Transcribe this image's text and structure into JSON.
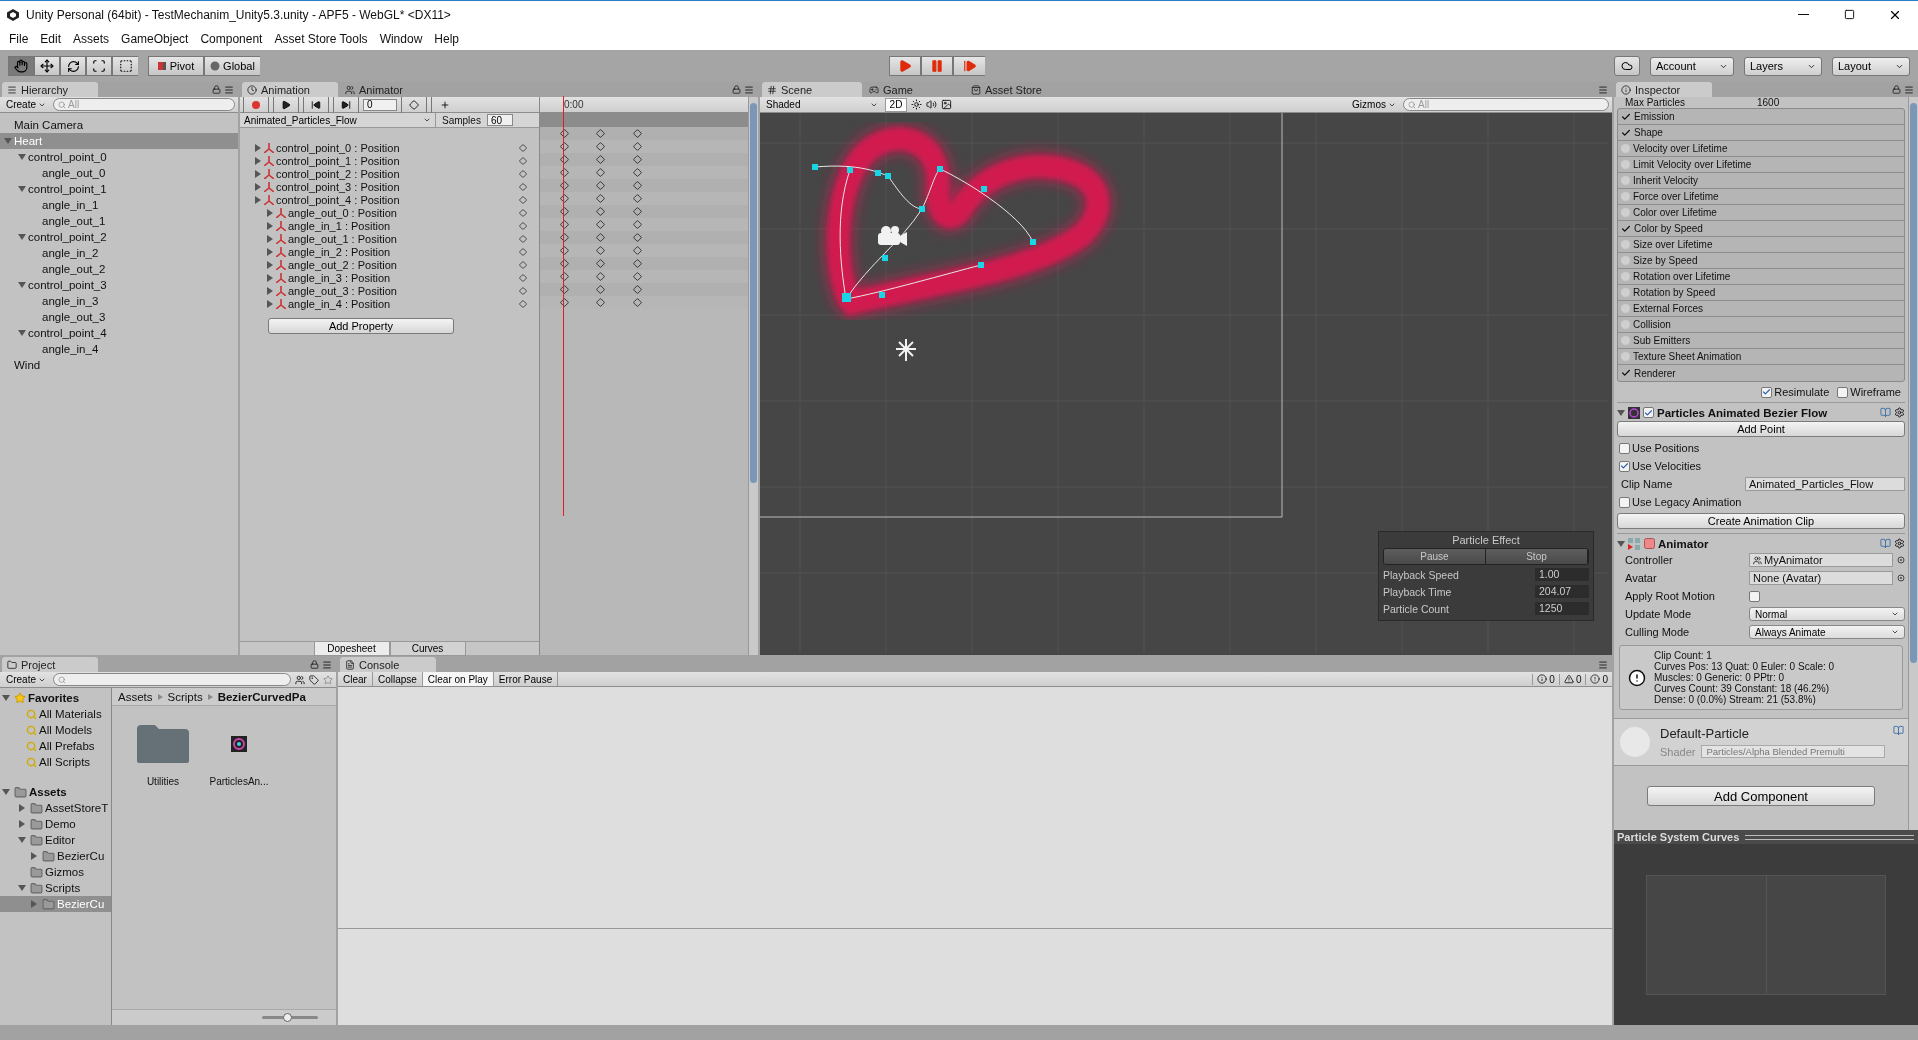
{
  "window": {
    "title": "Unity Personal (64bit) - TestMechanim_Unity5.3.unity - APF5 - WebGL* <DX11>"
  },
  "menu": [
    "File",
    "Edit",
    "Assets",
    "GameObject",
    "Component",
    "Asset Store Tools",
    "Window",
    "Help"
  ],
  "toolbar": {
    "tools": [
      {
        "kind": "hand",
        "selected": true
      },
      {
        "kind": "move",
        "selected": false
      },
      {
        "kind": "rotate",
        "selected": false
      },
      {
        "kind": "scale",
        "selected": false
      },
      {
        "kind": "rect",
        "selected": false
      }
    ],
    "pivot": "Pivot",
    "global": "Global",
    "account": "Account",
    "layers": "Layers",
    "layout": "Layout"
  },
  "hierarchy": {
    "tab": "Hierarchy",
    "create": "Create",
    "search_placeholder": "All",
    "items": [
      {
        "label": "Main Camera",
        "selected": false
      },
      {
        "label": "Heart",
        "selected": true,
        "expanded": true,
        "children": [
          {
            "label": "control_point_0",
            "selected": false,
            "expanded": true,
            "children": [
              {
                "label": "angle_out_0",
                "selected": false
              }
            ]
          },
          {
            "label": "control_point_1",
            "selected": false,
            "expanded": true,
            "children": [
              {
                "label": "angle_in_1",
                "selected": false
              },
              {
                "label": "angle_out_1",
                "selected": false
              }
            ]
          },
          {
            "label": "control_point_2",
            "selected": false,
            "expanded": true,
            "children": [
              {
                "label": "angle_in_2",
                "selected": false
              },
              {
                "label": "angle_out_2",
                "selected": false
              }
            ]
          },
          {
            "label": "control_point_3",
            "selected": false,
            "expanded": true,
            "children": [
              {
                "label": "angle_in_3",
                "selected": false
              },
              {
                "label": "angle_out_3",
                "selected": false
              }
            ]
          },
          {
            "label": "control_point_4",
            "selected": false,
            "expanded": true,
            "children": [
              {
                "label": "angle_in_4",
                "selected": false
              }
            ]
          }
        ]
      },
      {
        "label": "Wind",
        "selected": false
      }
    ]
  },
  "animation": {
    "tabs": [
      {
        "label": "Animation",
        "selected": true
      },
      {
        "label": "Animator",
        "selected": false
      }
    ],
    "frame": "0",
    "clip": "Animated_Particles_Flow",
    "samples_label": "Samples",
    "samples": "60",
    "time": "0:00",
    "properties": [
      {
        "label": "control_point_0 : Position",
        "kind": "top"
      },
      {
        "label": "control_point_1 : Position",
        "kind": "top"
      },
      {
        "label": "control_point_2 : Position",
        "kind": "top"
      },
      {
        "label": "control_point_3 : Position",
        "kind": "top"
      },
      {
        "label": "control_point_4 : Position",
        "kind": "top"
      },
      {
        "label": "angle_out_0 : Position",
        "kind": "nested"
      },
      {
        "label": "angle_in_1 : Position",
        "kind": "nested"
      },
      {
        "label": "angle_out_1 : Position",
        "kind": "nested"
      },
      {
        "label": "angle_in_2 : Position",
        "kind": "nested"
      },
      {
        "label": "angle_out_2 : Position",
        "kind": "nested"
      },
      {
        "label": "angle_in_3 : Position",
        "kind": "nested"
      },
      {
        "label": "angle_out_3 : Position",
        "kind": "nested"
      },
      {
        "label": "angle_in_4 : Position",
        "kind": "nested"
      }
    ],
    "add_property": "Add Property",
    "views": [
      {
        "label": "Dopesheet",
        "selected": true
      },
      {
        "label": "Curves",
        "selected": false
      }
    ]
  },
  "scene": {
    "tabs": [
      {
        "label": "Scene",
        "kind": "scene",
        "selected": true
      },
      {
        "label": "Game",
        "kind": "game",
        "selected": false
      },
      {
        "label": "Asset Store",
        "kind": "store",
        "selected": false
      }
    ],
    "shading": "Shaded",
    "mode_2d": "2D",
    "gizmos": "Gizmos",
    "search_placeholder": "All",
    "particle_effect": {
      "title": "Particle Effect",
      "buttons": [
        "Pause",
        "Stop"
      ],
      "fields": [
        {
          "label": "Playback Speed",
          "value": "1.00"
        },
        {
          "label": "Playback Time",
          "value": "204.07"
        },
        {
          "label": "Particle Count",
          "value": "1250"
        }
      ]
    }
  },
  "inspector": {
    "tab": "Inspector",
    "max_particles": {
      "label": "Max Particles",
      "value": "1600"
    },
    "modules": [
      {
        "label": "Emission",
        "checked": true
      },
      {
        "label": "Shape",
        "checked": true
      },
      {
        "label": "Velocity over Lifetime",
        "checked": false
      },
      {
        "label": "Limit Velocity over Lifetime",
        "checked": false
      },
      {
        "label": "Inherit Velocity",
        "checked": false
      },
      {
        "label": "Force over Lifetime",
        "checked": false
      },
      {
        "label": "Color over Lifetime",
        "checked": false
      },
      {
        "label": "Color by Speed",
        "checked": true
      },
      {
        "label": "Size over Lifetime",
        "checked": false
      },
      {
        "label": "Size by Speed",
        "checked": false
      },
      {
        "label": "Rotation over Lifetime",
        "checked": false
      },
      {
        "label": "Rotation by Speed",
        "checked": false
      },
      {
        "label": "External Forces",
        "checked": false
      },
      {
        "label": "Collision",
        "checked": false
      },
      {
        "label": "Sub Emitters",
        "checked": false
      },
      {
        "label": "Texture Sheet Animation",
        "checked": false
      },
      {
        "label": "Renderer",
        "checked": true
      }
    ],
    "toggles": [
      {
        "label": "Resimulate",
        "checked": true
      },
      {
        "label": "Wireframe",
        "checked": false
      }
    ],
    "bezier": {
      "title": "Particles Animated Bezier Flow",
      "enabled": true,
      "add_point": "Add Point",
      "options": [
        {
          "label": "Use Positions",
          "checked": false
        },
        {
          "label": "Use Velocities",
          "checked": true
        }
      ],
      "clip_name_label": "Clip Name",
      "clip_name": "Animated_Particles_Flow",
      "legacy": {
        "label": "Use Legacy Animation",
        "checked": false
      },
      "create_clip": "Create Animation Clip"
    },
    "animator": {
      "title": "Animator",
      "fields": [
        {
          "label": "Controller",
          "kind": "object",
          "value": "MyAnimator"
        },
        {
          "label": "Avatar",
          "kind": "object",
          "value": "None (Avatar)"
        },
        {
          "label": "Apply Root Motion",
          "kind": "checkbox",
          "checked": false
        },
        {
          "label": "Update Mode",
          "kind": "dropdown",
          "value": "Normal"
        },
        {
          "label": "Culling Mode",
          "kind": "dropdown",
          "value": "Always Animate"
        }
      ],
      "info": [
        "Clip Count: 1",
        "Curves Pos: 13 Quat: 0 Euler: 0 Scale: 0",
        "Muscles: 0 Generic: 0 PPtr: 0",
        "Curves Count: 39 Constant: 18 (46.2%)",
        "Dense: 0 (0.0%) Stream: 21 (53.8%)"
      ]
    },
    "material": {
      "name": "Default-Particle",
      "shader_label": "Shader",
      "shader": "Particles/Alpha Blended Premulti"
    },
    "add_component": "Add Component"
  },
  "curves": {
    "title": "Particle System Curves"
  },
  "project": {
    "tab": "Project",
    "create": "Create",
    "favorites": {
      "label": "Favorites",
      "expanded": true,
      "selected": false,
      "children": [
        {
          "label": "All Materials",
          "selected": false
        },
        {
          "label": "All Models",
          "selected": false
        },
        {
          "label": "All Prefabs",
          "selected": false
        },
        {
          "label": "All Scripts",
          "selected": false
        }
      ]
    },
    "assets": {
      "label": "Assets",
      "expanded": true,
      "selected": false,
      "children": [
        {
          "label": "AssetStoreT",
          "expanded": false,
          "selected": false
        },
        {
          "label": "Demo",
          "expanded": false,
          "selected": false
        },
        {
          "label": "Editor",
          "expanded": true,
          "selected": false,
          "children": [
            {
              "label": "BezierCu",
              "expanded": false,
              "selected": false
            }
          ]
        },
        {
          "label": "Gizmos",
          "selected": false
        },
        {
          "label": "Scripts",
          "expanded": true,
          "selected": false,
          "children": [
            {
              "label": "BezierCu",
              "expanded": false,
              "selected": true
            }
          ]
        }
      ]
    },
    "breadcrumb": [
      "Assets",
      "Scripts",
      "BezierCurvedPa"
    ],
    "files": [
      {
        "name": "Utilities",
        "kind": "folder"
      },
      {
        "name": "ParticlesAn...",
        "kind": "script"
      }
    ],
    "zoom_slider": {
      "level": 0.45
    }
  },
  "console": {
    "tab": "Console",
    "buttons": [
      {
        "label": "Clear",
        "selected": false
      },
      {
        "label": "Collapse",
        "selected": false
      },
      {
        "label": "Clear on Play",
        "selected": true
      },
      {
        "label": "Error Pause",
        "selected": false
      }
    ],
    "counts": [
      {
        "kind": "info",
        "value": "0"
      },
      {
        "kind": "warning",
        "value": "0"
      },
      {
        "kind": "error",
        "value": "0"
      }
    ]
  }
}
